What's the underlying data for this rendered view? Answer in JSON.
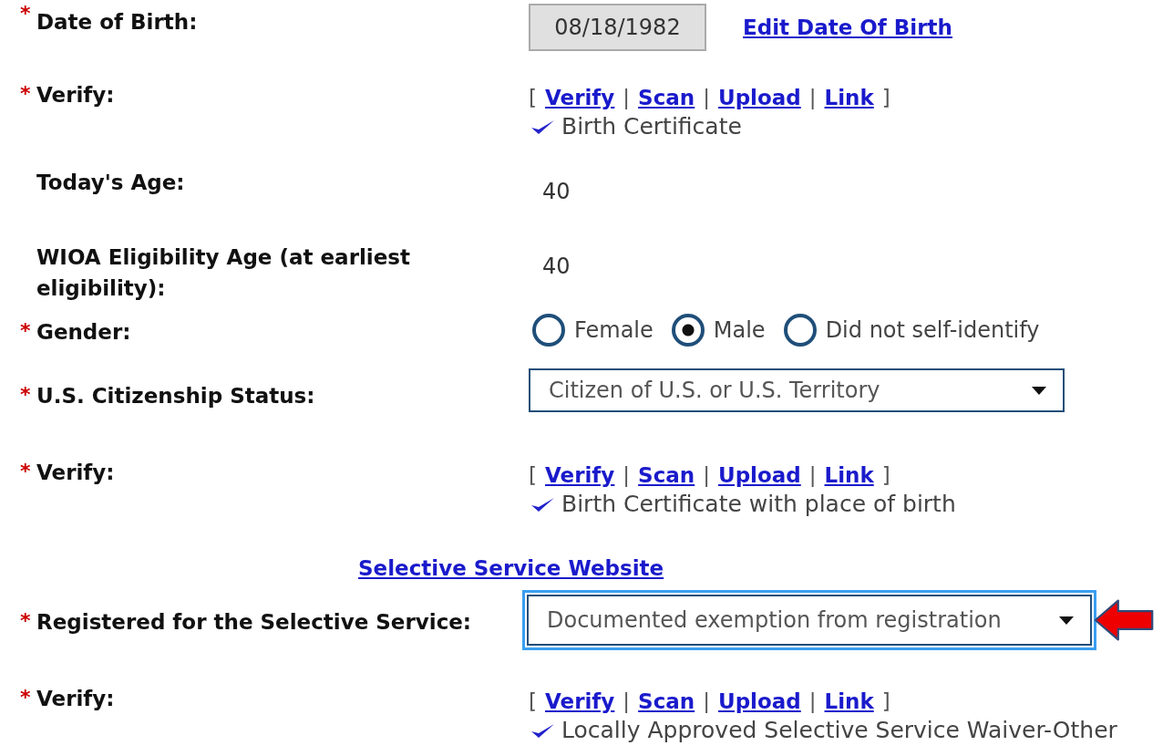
{
  "rows": [
    {
      "kind": "date",
      "marker": "*",
      "label": "Date of Birth:",
      "value": "08/18/1982",
      "link": "Edit Date Of Birth"
    },
    {
      "kind": "verify",
      "marker": "*",
      "label": "Verify:",
      "open": "[",
      "separator": "|",
      "close": "]",
      "links": [
        "Verify",
        "Scan",
        "Upload",
        "Link"
      ],
      "document": "Birth Certificate"
    },
    {
      "kind": "text",
      "label": "Today's Age:",
      "value": "40"
    },
    {
      "kind": "text",
      "label": "WIOA Eligibility Age (at earliest eligibility):",
      "value": "40"
    },
    {
      "kind": "radio",
      "marker": "*",
      "label": "Gender:",
      "options": [
        {
          "label": "Female",
          "selected": false
        },
        {
          "label": "Male",
          "selected": true
        },
        {
          "label": "Did not self-identify",
          "selected": false
        }
      ]
    },
    {
      "kind": "select",
      "marker": "*",
      "label": "U.S. Citizenship Status:",
      "value": "Citizen of U.S. or U.S. Territory",
      "focused": false
    },
    {
      "kind": "verify",
      "marker": "*",
      "label": "Verify:",
      "open": "[",
      "separator": "|",
      "close": "]",
      "links": [
        "Verify",
        "Scan",
        "Upload",
        "Link"
      ],
      "document": "Birth Certificate with place of birth"
    },
    {
      "kind": "link",
      "link": "Selective Service Website"
    },
    {
      "kind": "select",
      "marker": "*",
      "label": "Registered for the Selective Service:",
      "value": "Documented exemption from registration",
      "focused": true
    },
    {
      "kind": "verify",
      "marker": "*",
      "label": "Verify:",
      "open": "[",
      "separator": "|",
      "close": "]",
      "links": [
        "Verify",
        "Scan",
        "Upload",
        "Link"
      ],
      "document": "Locally Approved Selective Service Waiver-Other"
    }
  ]
}
